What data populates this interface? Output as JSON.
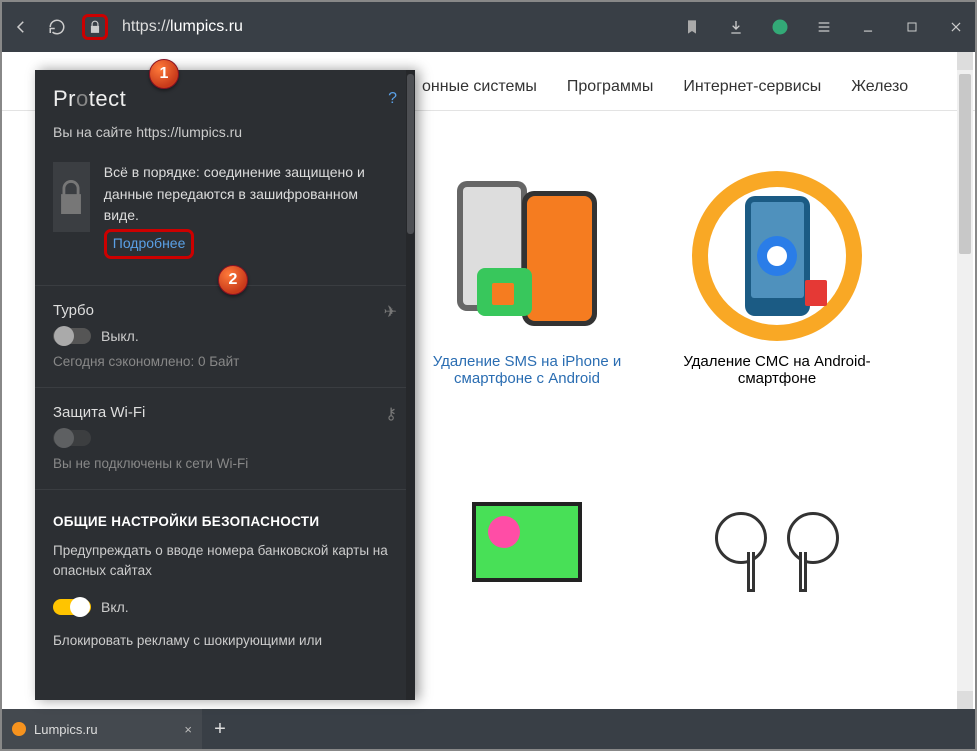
{
  "chrome": {
    "url_prefix": "https://",
    "url_host": "lumpics.ru"
  },
  "markers": {
    "m1": "1",
    "m2": "2"
  },
  "protect": {
    "title_prefix": "Pr",
    "title_o": "o",
    "title_suffix": "tect",
    "help": "?",
    "site_line": "Вы на сайте https://lumpics.ru",
    "secure_msg": "Всё в порядке: соединение защищено и данные передаются в зашифрованном виде.",
    "more": "Подробнее",
    "turbo": {
      "label": "Турбо",
      "state": "Выкл.",
      "saved": "Сегодня сэкономлено: 0 Байт"
    },
    "wifi": {
      "label": "Защита Wi-Fi",
      "msg": "Вы не подключены к сети Wi-Fi"
    },
    "sec_head": "ОБЩИЕ НАСТРОЙКИ БЕЗОПАСНОСТИ",
    "card_warn": {
      "text": "Предупреждать о вводе номера банковской карты на опасных сайтах",
      "state": "Вкл."
    },
    "ad_block": "Блокировать рекламу с шокирующими или"
  },
  "nav": {
    "t1": "онные системы",
    "t2": "Программы",
    "t3": "Интернет-сервисы",
    "t4": "Железо"
  },
  "cards": {
    "c1": "Удаление SMS на iPhone и смартфоне с Android",
    "c2": "Удаление СМС на Android-смартфоне"
  },
  "tab": {
    "title": "Lumpics.ru",
    "close": "×",
    "new": "+"
  }
}
